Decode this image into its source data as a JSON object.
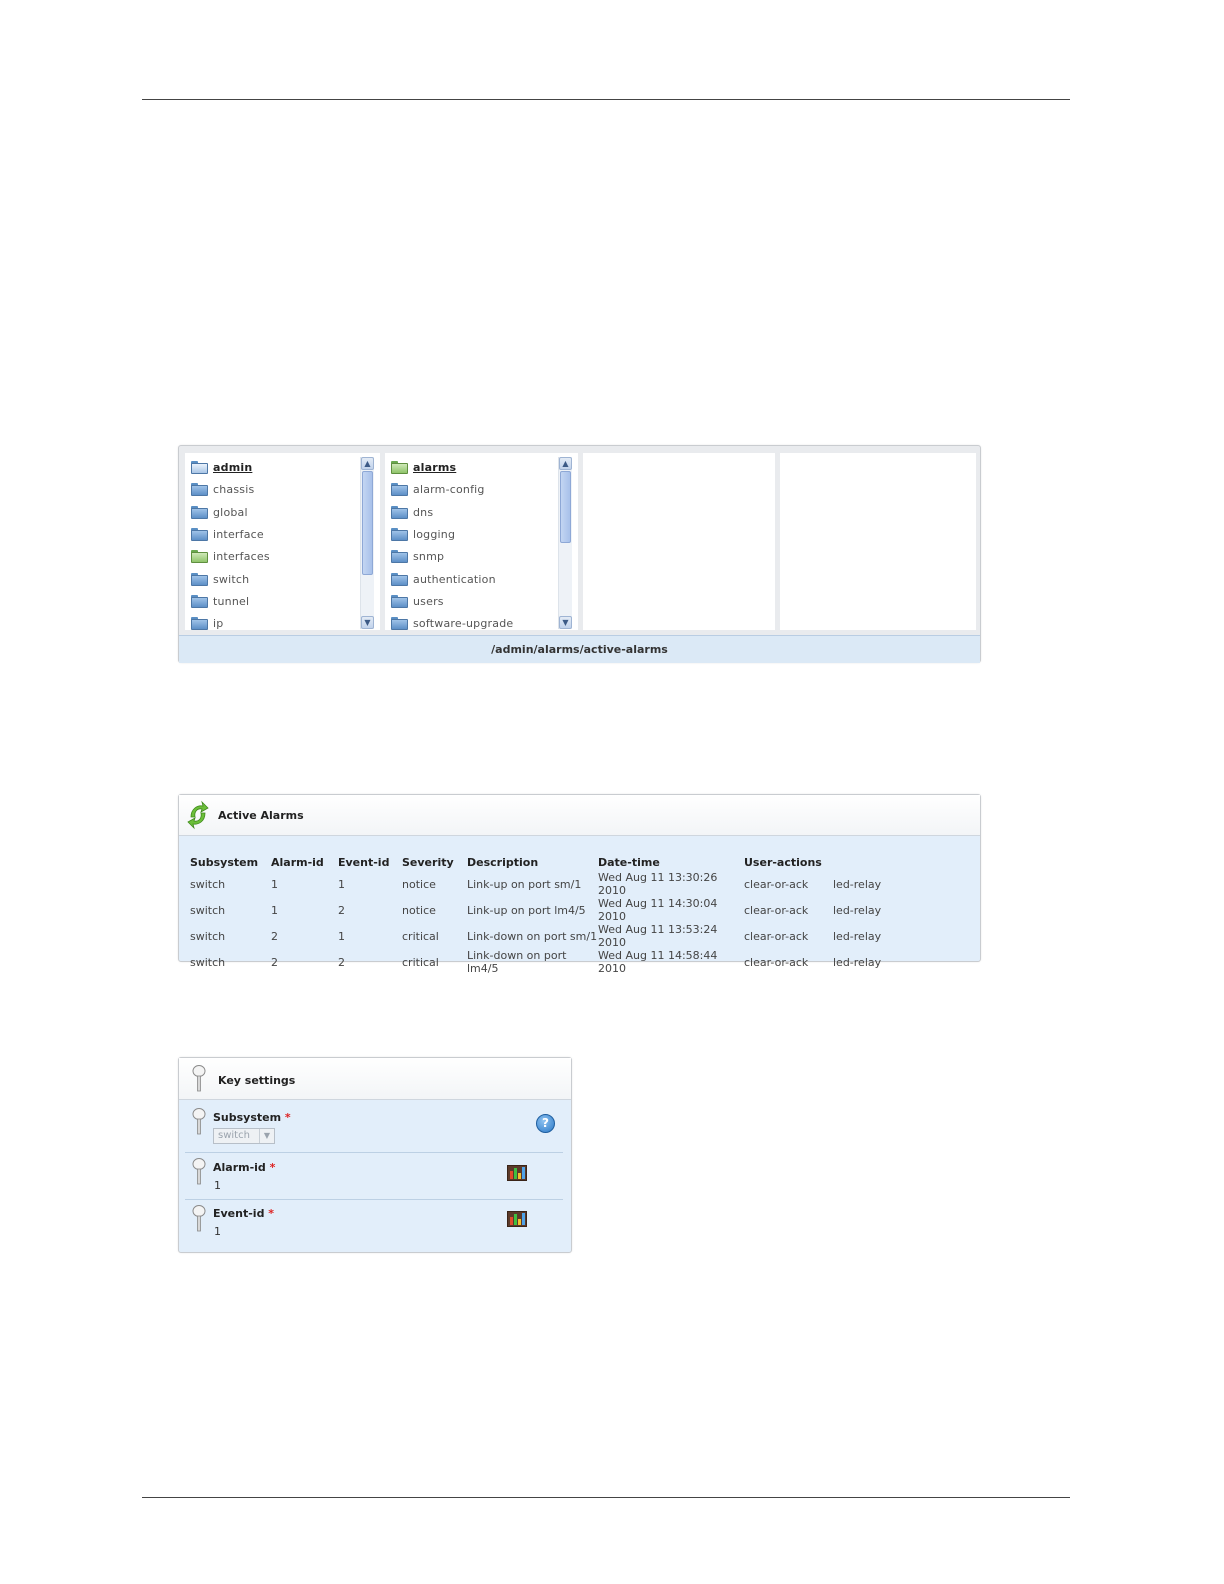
{
  "browser": {
    "column1": [
      "admin",
      "chassis",
      "global",
      "interface",
      "interfaces",
      "switch",
      "tunnel",
      "ip"
    ],
    "column2": [
      "alarms",
      "alarm-config",
      "dns",
      "logging",
      "snmp",
      "authentication",
      "users",
      "software-upgrade"
    ],
    "path": "/admin/alarms/active-alarms"
  },
  "alarms": {
    "title": "Active Alarms",
    "headers": [
      "Subsystem",
      "Alarm-id",
      "Event-id",
      "Severity",
      "Description",
      "Date-time",
      "User-actions"
    ],
    "rows": [
      [
        "switch",
        "1",
        "1",
        "notice",
        "Link-up on port sm/1",
        "Wed Aug 11 13:30:26 2010",
        "clear-or-ack",
        "led-relay"
      ],
      [
        "switch",
        "1",
        "2",
        "notice",
        "Link-up on port lm4/5",
        "Wed Aug 11 14:30:04 2010",
        "clear-or-ack",
        "led-relay"
      ],
      [
        "switch",
        "2",
        "1",
        "critical",
        "Link-down on port sm/1",
        "Wed Aug 11 13:53:24 2010",
        "clear-or-ack",
        "led-relay"
      ],
      [
        "switch",
        "2",
        "2",
        "critical",
        "Link-down on port lm4/5",
        "Wed Aug 11 14:58:44 2010",
        "clear-or-ack",
        "led-relay"
      ]
    ]
  },
  "keys": {
    "title": "Key settings",
    "required_mark": "*",
    "help_glyph": "?",
    "subsystem": {
      "label": "Subsystem",
      "value": "switch"
    },
    "alarm_id": {
      "label": "Alarm-id",
      "value": "1"
    },
    "event_id": {
      "label": "Event-id",
      "value": "1"
    }
  },
  "icons": {
    "folder": "folder-icon",
    "refresh": "refresh-icon",
    "key": "key-pin-icon",
    "help": "help-icon",
    "chart": "bar-chart-icon"
  },
  "colors": {
    "panel_bg": "#e2eefa",
    "path_bar": "#dbe9f6",
    "required": "#dd2222",
    "folder_blue": "#5d8fc7",
    "folder_green": "#8fc46a"
  }
}
